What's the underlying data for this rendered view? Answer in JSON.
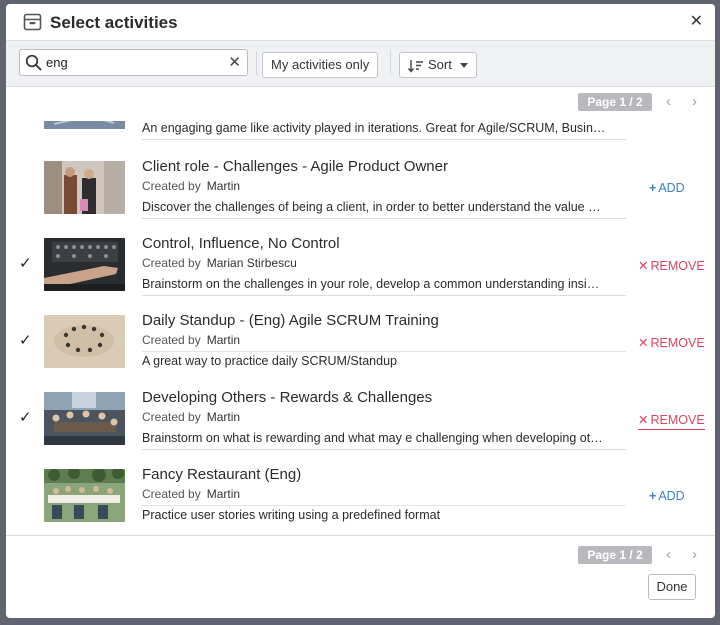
{
  "dialog": {
    "title": "Select activities",
    "title_icon": "box-icon",
    "close_glyph": "✕"
  },
  "toolbar": {
    "search_value": "eng",
    "search_icon": "search-icon",
    "clear_glyph": "✕",
    "my_activities_label": "My activities only",
    "sort_label": "Sort"
  },
  "pager_top": {
    "label": "Page 1 / 2",
    "prev": "‹",
    "next": "›"
  },
  "pager_bottom": {
    "label": "Page 1 / 2",
    "prev": "‹",
    "next": "›"
  },
  "activities": [
    {
      "name": "",
      "created_by_label": "",
      "creator": "",
      "description": "An engaging game like activity played in iterations. Great for Agile/SCRUM, Busin…",
      "selected": false,
      "action_label": "",
      "partial": true
    },
    {
      "name": "Client role - Challenges - Agile Product Owner",
      "created_by_label": "Created by",
      "creator": "Martin",
      "description": "Discover the challenges of being a client, in order to better understand the value …",
      "selected": false,
      "action_symbol": "+",
      "action_label": "ADD"
    },
    {
      "name": "Control, Influence, No Control",
      "created_by_label": "Created by",
      "creator": "Marian Stirbescu",
      "description": "Brainstorm on the challenges in your role, develop a common understanding insi…",
      "selected": true,
      "check_glyph": "✓",
      "action_symbol": "✕",
      "action_label": "REMOVE"
    },
    {
      "name": "Daily Standup - (Eng) Agile SCRUM Training",
      "created_by_label": "Created by",
      "creator": "Martin",
      "description": "A great way to practice daily SCRUM/Standup",
      "selected": true,
      "check_glyph": "✓",
      "action_symbol": "✕",
      "action_label": "REMOVE"
    },
    {
      "name": "Developing Others - Rewards & Challenges",
      "created_by_label": "Created by",
      "creator": "Martin",
      "description": "Brainstorm on what is rewarding and what may e challenging when developing ot…",
      "selected": true,
      "check_glyph": "✓",
      "action_symbol": "✕",
      "action_label": "REMOVE"
    },
    {
      "name": "Fancy Restaurant (Eng)",
      "created_by_label": "Created by",
      "creator": "Martin",
      "description": "Practice user stories writing using a predefined format",
      "selected": false,
      "action_symbol": "+",
      "action_label": "ADD"
    }
  ],
  "footer": {
    "done_label": "Done"
  },
  "colors": {
    "add": "#3b82c4",
    "remove": "#d9455f",
    "pager_badge": "#b7b9bc",
    "toolbar_bg": "#f0f1f3",
    "backdrop": "#5f6470"
  }
}
